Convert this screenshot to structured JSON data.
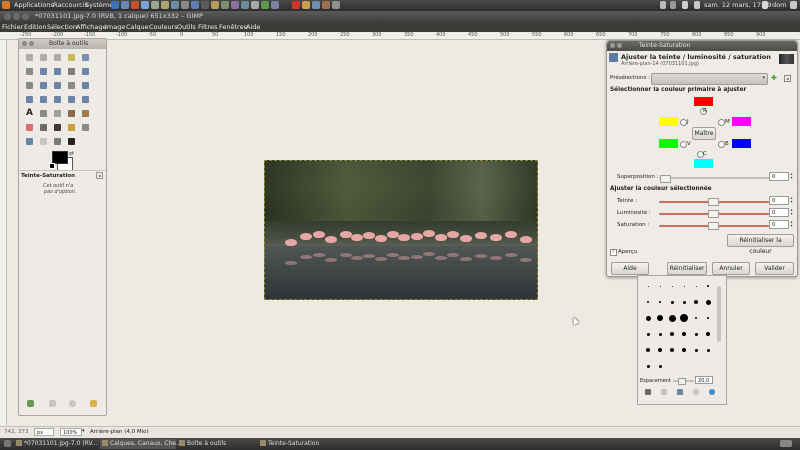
{
  "top_panel": {
    "applications": "Applications",
    "places": "Raccourcis",
    "system": "Système",
    "datetime": "sam. 12 mars, 17:09",
    "user": "dom"
  },
  "window": {
    "title": "*07031101.jpg-7.0 (RVB, 1 calque) 651x332 – GIMP"
  },
  "menubar": [
    "Fichier",
    "Edition",
    "Sélection",
    "Affichage",
    "Image",
    "Calque",
    "Couleurs",
    "Outils",
    "Filtres",
    "Fenêtres",
    "Aide"
  ],
  "ruler": {
    "ticks": [
      "-250",
      "-200",
      "-150",
      "-100",
      "-50",
      "0",
      "50",
      "100",
      "150",
      "200",
      "250",
      "300",
      "350",
      "400",
      "450",
      "500",
      "550",
      "600",
      "650",
      "700",
      "750",
      "800",
      "850",
      "900"
    ]
  },
  "toolbox": {
    "title": "Boîte à outils",
    "fg_color": "#000000",
    "bg_color": "#ffffff",
    "tool_options_title": "Teinte-Saturation",
    "tool_options_text1": "Cet outil n'a",
    "tool_options_text2": "pas d'option."
  },
  "hue_saturation": {
    "window_title": "Teinte-Saturation",
    "heading": "Ajuster la teinte / luminosité / saturation",
    "subheading": "Arrière-plan-14 (07031101.jpg)",
    "presets_label": "Présélections :",
    "primary_section": "Sélectionner la couleur primaire à ajuster",
    "primary_colors": {
      "R": {
        "label": "R",
        "color": "#ff0000"
      },
      "J": {
        "label": "J",
        "color": "#ffff00"
      },
      "M": {
        "label": "M",
        "color": "#ff00ff"
      },
      "V": {
        "label": "V",
        "color": "#00ff00"
      },
      "B": {
        "label": "B",
        "color": "#0000ff"
      },
      "C": {
        "label": "C",
        "color": "#00ffff"
      }
    },
    "master_button": "Maître",
    "overlap_label": "Superposition :",
    "overlap_value": "0",
    "adjust_section": "Ajuster la couleur sélectionnée",
    "hue_label": "Teinte :",
    "hue_value": "0",
    "lightness_label": "Luminosité :",
    "lightness_value": "0",
    "saturation_label": "Saturation :",
    "saturation_value": "0",
    "reset_color_button": "Réinitialiser la couleur",
    "preview_label": "Aperçu",
    "preview_checked": true,
    "buttons": {
      "help": "Aide",
      "reset": "Réinitialiser",
      "cancel": "Annuler",
      "ok": "Valider"
    }
  },
  "brushes": {
    "spacing_label": "Espacement :",
    "spacing_value": "20,0"
  },
  "statusbar": {
    "coords": "742, 373",
    "unit": "px",
    "zoom": "100%",
    "message": "Arrière-plan (4,0 Mio)"
  },
  "taskbar": {
    "items": [
      "*07031101.jpg-7.0 (RV...",
      "Calques, Canaux, Che...",
      "Boîte à outils",
      "Teinte-Saturation"
    ]
  }
}
